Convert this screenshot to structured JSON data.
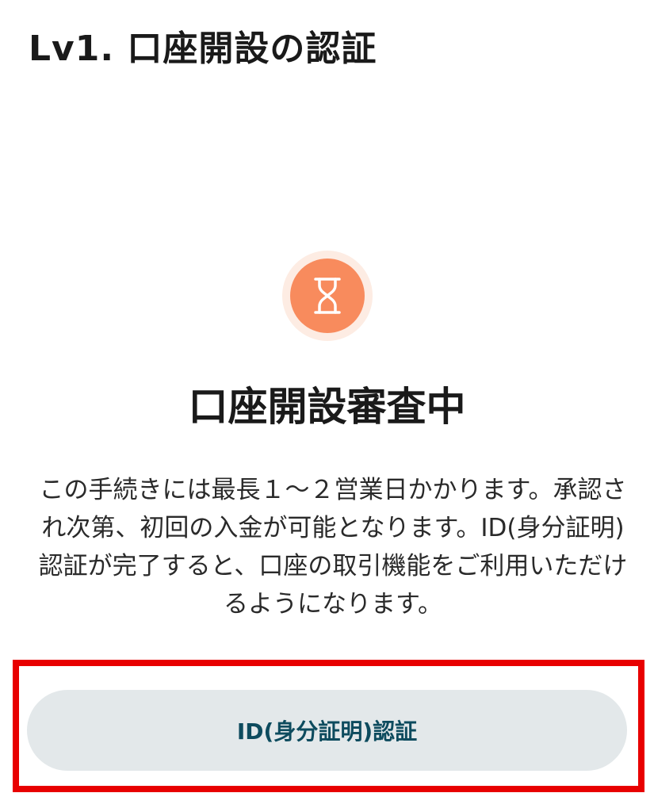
{
  "header": {
    "title": "Lv1. 口座開設の認証"
  },
  "status": {
    "icon": "hourglass-icon",
    "icon_color": "#f88b5d",
    "icon_ring_color": "#fdece3",
    "heading": "口座開設審査中",
    "description": "この手続きには最長１〜２営業日かかります。承認され次第、初回の入金が可能となります。ID(身分証明)認証が完了すると、口座の取引機能をご利用いただけるようになります。"
  },
  "actions": {
    "id_verify_label": "ID(身分証明)認証",
    "button_text_color": "#0d4b5e",
    "button_bg_color": "#e3e8ea",
    "highlight_color": "#e80000"
  }
}
